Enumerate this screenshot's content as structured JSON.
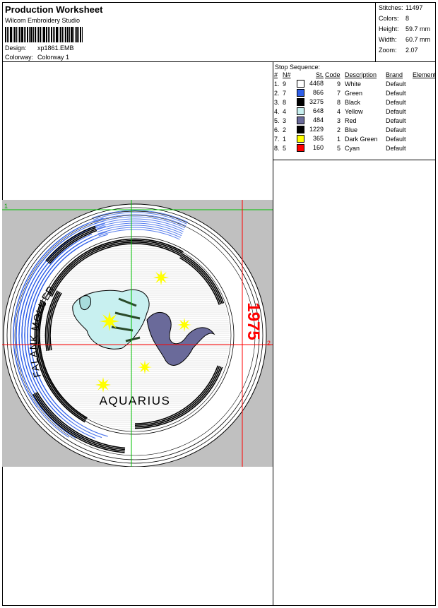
{
  "header": {
    "title": "Production Worksheet",
    "software": "Wilcom Embroidery Studio",
    "design_label": "Design:",
    "design_value": "xp1861.EMB",
    "colorway_label": "Colorway:",
    "colorway_value": "Colorway 1"
  },
  "stats": {
    "stitches_label": "Stitches:",
    "stitches": "11497",
    "colors_label": "Colors:",
    "colors": "8",
    "height_label": "Height:",
    "height": "59.7 mm",
    "width_label": "Width:",
    "width": "60.7 mm",
    "zoom_label": "Zoom:",
    "zoom": "2.07"
  },
  "stop_sequence": {
    "title": "Stop Sequence:",
    "columns": [
      "#",
      "N#",
      "St.",
      "Code",
      "Description",
      "Brand",
      "Element"
    ],
    "rows": [
      {
        "idx": "1.",
        "n": "9",
        "color": "#ffffff",
        "st": "4468",
        "code": "9",
        "desc": "White",
        "brand": "Default"
      },
      {
        "idx": "2.",
        "n": "7",
        "color": "#2f5fe8",
        "st": "866",
        "code": "7",
        "desc": "Green",
        "brand": "Default"
      },
      {
        "idx": "3.",
        "n": "8",
        "color": "#000000",
        "st": "3275",
        "code": "8",
        "desc": "Black",
        "brand": "Default"
      },
      {
        "idx": "4.",
        "n": "4",
        "color": "#c8f0f0",
        "st": "648",
        "code": "4",
        "desc": "Yellow",
        "brand": "Default"
      },
      {
        "idx": "5.",
        "n": "3",
        "color": "#6a6a9a",
        "st": "484",
        "code": "3",
        "desc": "Red",
        "brand": "Default"
      },
      {
        "idx": "6.",
        "n": "2",
        "color": "#000000",
        "st": "1229",
        "code": "2",
        "desc": "Blue",
        "brand": "Default"
      },
      {
        "idx": "7.",
        "n": "1",
        "color": "#ffff00",
        "st": "365",
        "code": "1",
        "desc": "Dark Green",
        "brand": "Default"
      },
      {
        "idx": "8.",
        "n": "5",
        "color": "#ff0000",
        "st": "160",
        "code": "5",
        "desc": "Cyan",
        "brand": "Default"
      }
    ]
  },
  "design": {
    "ring_text": "FALANK MOLUER",
    "center_text": "AQUARIUS",
    "year_text": "1975",
    "marker_1": "1",
    "marker_2": "2",
    "colors": {
      "blue": "#2f5fe8",
      "red": "#ff0000",
      "yellow": "#ffff00",
      "green": "#00c000",
      "pale": "#c8f0f0",
      "grey": "#6a6a9a"
    }
  }
}
